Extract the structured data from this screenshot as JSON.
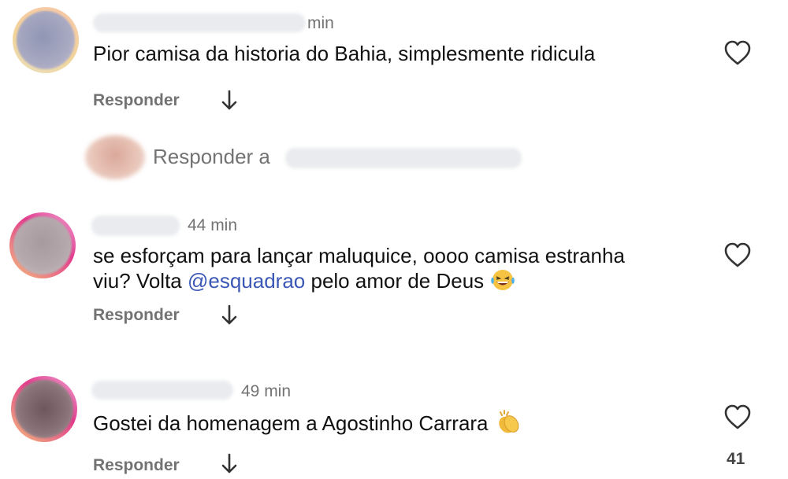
{
  "comments": [
    {
      "time": "min",
      "text": "Pior camisa da historia do Bahia, simplesmente ridicula",
      "reply_label": "Responder"
    },
    {
      "time": "44 min",
      "text_before": "se esforçam para lançar maluquice, oooo camisa estranha",
      "text_line2_start": "viu? Volta ",
      "mention": "@esquadrao",
      "text_after": " pelo amor de Deus",
      "emoji": "laughing-tears",
      "reply_label": "Responder"
    },
    {
      "time": "49 min",
      "text": "Gostei da homenagem a Agostinho Carrara",
      "emoji": "clapping-hands",
      "reply_label": "Responder",
      "like_count": "41"
    }
  ],
  "reply_box": {
    "placeholder": "Responder a"
  },
  "icons": {
    "heart": "heart-outline-icon",
    "arrow": "arrow-down-icon"
  }
}
